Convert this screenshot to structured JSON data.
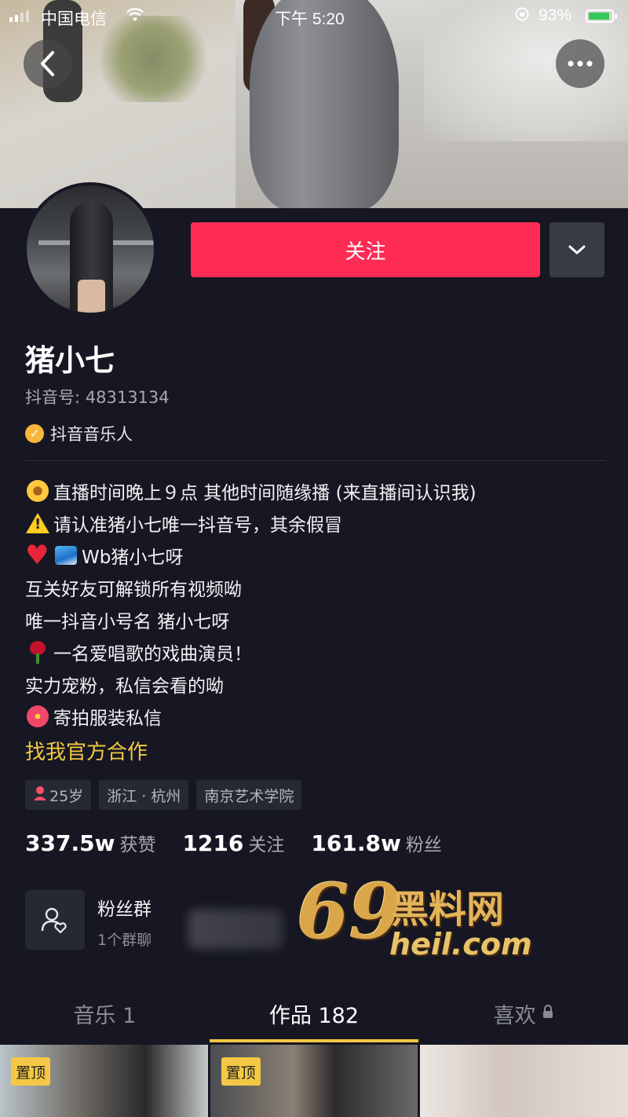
{
  "status_bar": {
    "carrier": "中国电信",
    "time": "下午 5:20",
    "battery_percent": "93%",
    "signal_icon": "signal-icon",
    "wifi_icon": "wifi-icon",
    "battery_icon": "battery-charging-icon"
  },
  "nav": {
    "back_icon": "chevron-left-icon",
    "more_icon": "more-dots-icon"
  },
  "profile": {
    "follow_label": "关注",
    "dropdown_icon": "chevron-down-icon",
    "name": "猪小七",
    "douyin_id": "抖音号: 48313134",
    "badge": "抖音音乐人",
    "bio": [
      {
        "emoji": "flower",
        "text": "直播时间晚上９点 其他时间随缘播 (来直播间认识我)"
      },
      {
        "emoji": "warning",
        "text": "请认准猪小七唯一抖音号，其余假冒"
      },
      {
        "emoji": "heart",
        "emoji2": "wave",
        "text": "Wb猪小七呀"
      },
      {
        "emoji": "",
        "text": "互关好友可解锁所有视频呦"
      },
      {
        "emoji": "",
        "text": "唯一抖音小号名 猪小七呀"
      },
      {
        "emoji": "rose",
        "text": "一名爱唱歌的戏曲演员！"
      },
      {
        "emoji": "",
        "text": "实力宠粉，私信会看的呦"
      },
      {
        "emoji": "hibiscus",
        "text": "寄拍服装私信"
      }
    ],
    "official_link": "找我官方合作",
    "tags": [
      "25岁",
      "浙江 · 杭州",
      "南京艺术学院"
    ],
    "stats": [
      {
        "num": "337.5w",
        "label": "获赞"
      },
      {
        "num": "1216",
        "label": "关注"
      },
      {
        "num": "161.8w",
        "label": "粉丝"
      }
    ]
  },
  "fan_group": {
    "title": "粉丝群",
    "subtitle": "1个群聊"
  },
  "watermark": {
    "big": "69",
    "cn": "黑料网",
    "url": "heil.com"
  },
  "tabs": [
    {
      "label": "音乐 1"
    },
    {
      "label": "作品 182"
    },
    {
      "label": "喜欢"
    }
  ],
  "thumbnails": [
    {
      "badge": "置顶"
    },
    {
      "badge": "置顶"
    },
    {
      "badge": ""
    }
  ]
}
